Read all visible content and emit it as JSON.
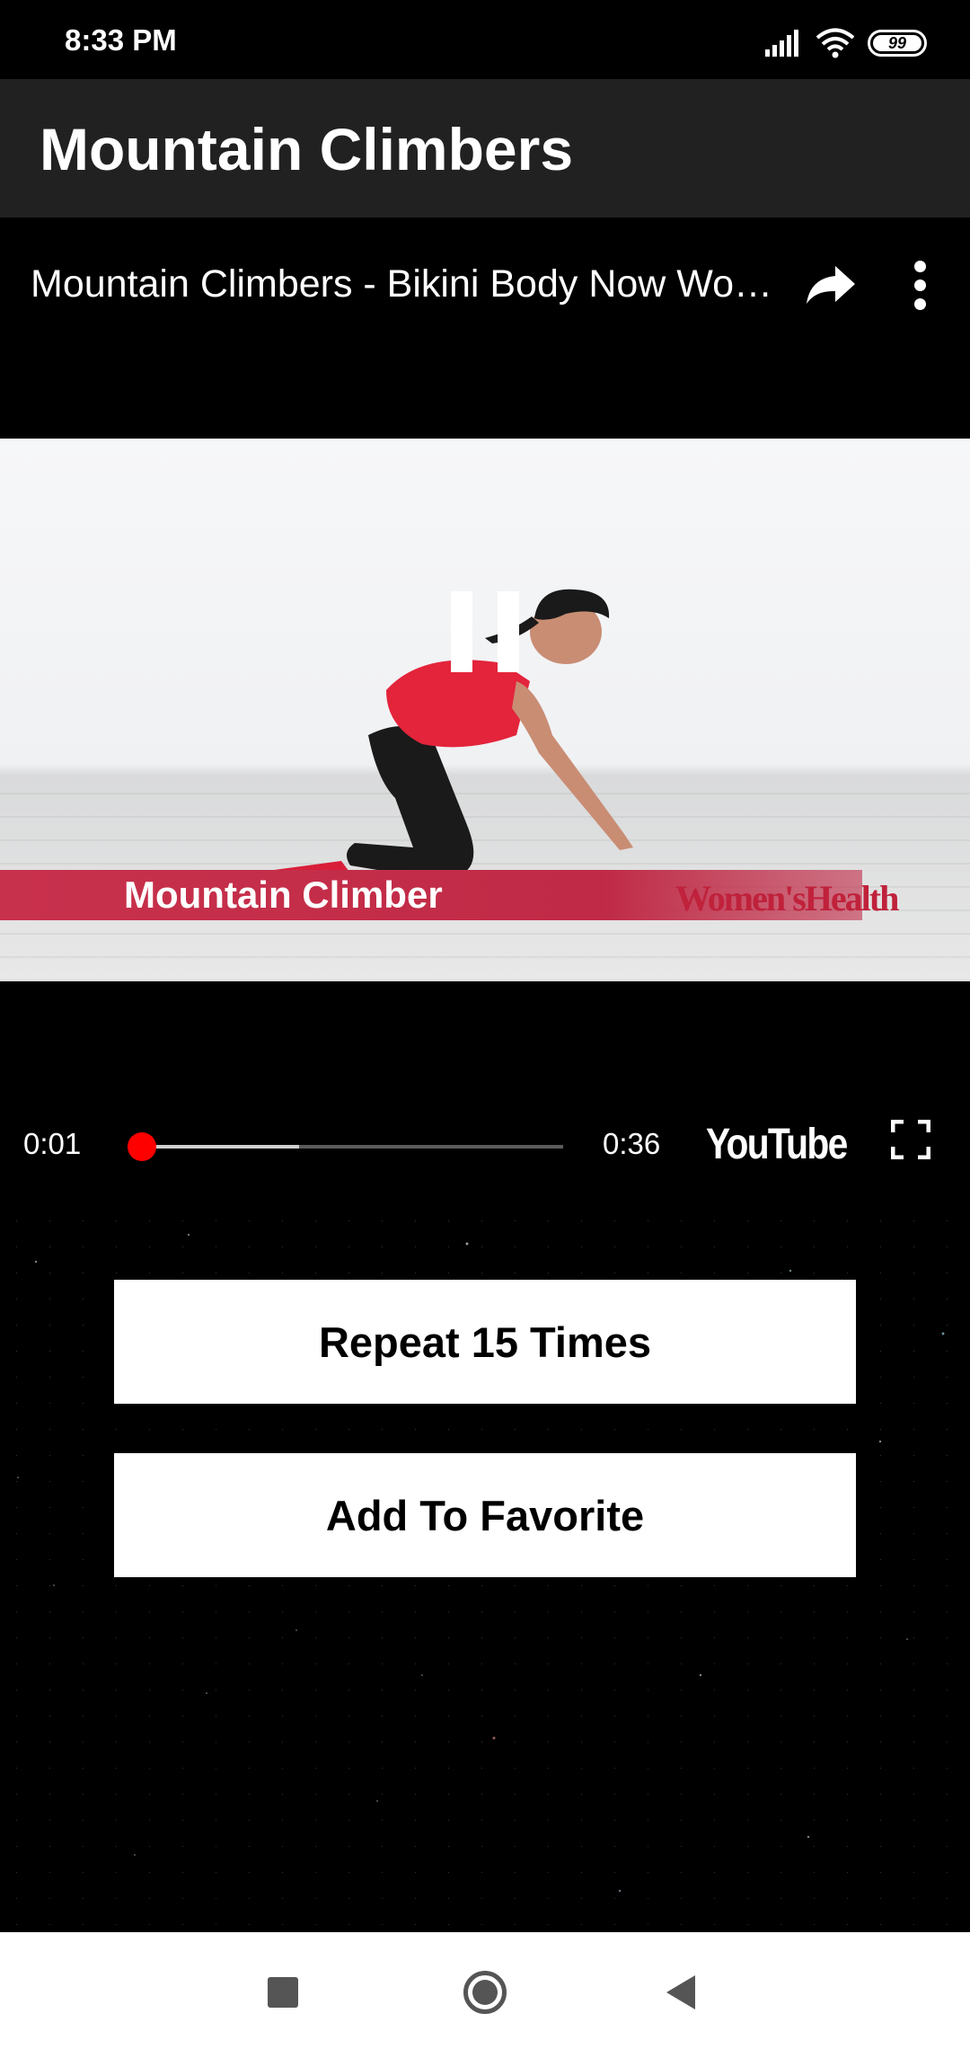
{
  "status_bar": {
    "time": "8:33 PM",
    "battery": "99"
  },
  "app_bar": {
    "title": "Mountain Climbers"
  },
  "player": {
    "video_title": "Mountain Climbers - Bikini Body Now Workout",
    "banner_text": "Mountain Climber",
    "banner_logo": "Women'sHealth",
    "current_time": "0:01",
    "total_time": "0:36",
    "played_fraction": 0.028,
    "buffered_fraction": 0.39,
    "brand": "YouTube",
    "state": "playing"
  },
  "actions": {
    "repeat_label": "Repeat 15 Times",
    "favorite_label": "Add To Favorite"
  },
  "colors": {
    "progress": "#ff0000",
    "app_bar": "#212121",
    "banner": "#c8314c"
  }
}
